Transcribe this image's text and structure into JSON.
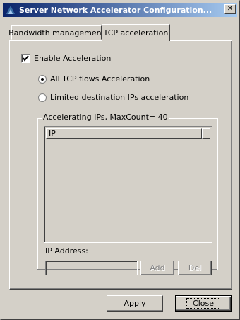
{
  "window": {
    "title": "Server Network Accelerator Configuration...",
    "close_glyph": "✕"
  },
  "tabs": [
    {
      "label": "Bandwidth management",
      "active": false
    },
    {
      "label": "TCP acceleration",
      "active": true
    }
  ],
  "options": {
    "enable_label": "Enable Acceleration",
    "enable_checked": true,
    "radio_all_label": "All TCP flows Acceleration",
    "radio_limited_label": "Limited destination IPs acceleration",
    "selected": "all"
  },
  "group": {
    "label": "Accelerating IPs,  MaxCount= 40",
    "columns": [
      "IP"
    ],
    "rows": []
  },
  "ip_input": {
    "label": "IP Address:",
    "separators": [
      ".",
      ".",
      "."
    ],
    "add_label": "Add",
    "del_label": "Del"
  },
  "buttons": {
    "apply": "Apply",
    "close": "Close"
  }
}
